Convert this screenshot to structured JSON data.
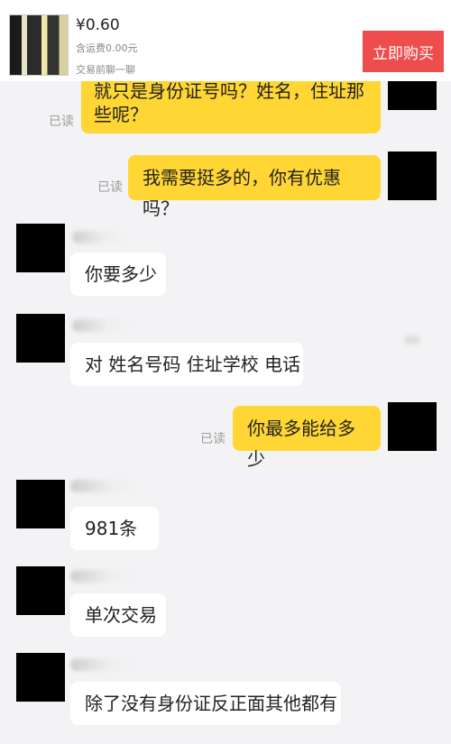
{
  "listing": {
    "price": "¥0.60",
    "shipping": "含运费0.00元",
    "chat_hint": "交易前聊一聊",
    "buy_label": "立即购买",
    "accent_color": "#ee4d4d"
  },
  "read_label": "已读",
  "messages": [
    {
      "side": "right",
      "text": "就只是身份证号吗？姓名，住址那些呢？"
    },
    {
      "side": "right",
      "text": "我需要挺多的，你有优惠吗？"
    },
    {
      "side": "left",
      "text": "你要多少"
    },
    {
      "side": "left",
      "text": "对 姓名号码 住址学校 电话"
    },
    {
      "side": "right",
      "text": "你最多能给多少"
    },
    {
      "side": "left",
      "text": "981条"
    },
    {
      "side": "left",
      "text": "单次交易"
    },
    {
      "side": "left",
      "text": "除了没有身份证反正面其他都有"
    }
  ],
  "colors": {
    "bubble_self": "#ffd633",
    "bubble_other": "#ffffff",
    "background": "#f3f3f5"
  }
}
